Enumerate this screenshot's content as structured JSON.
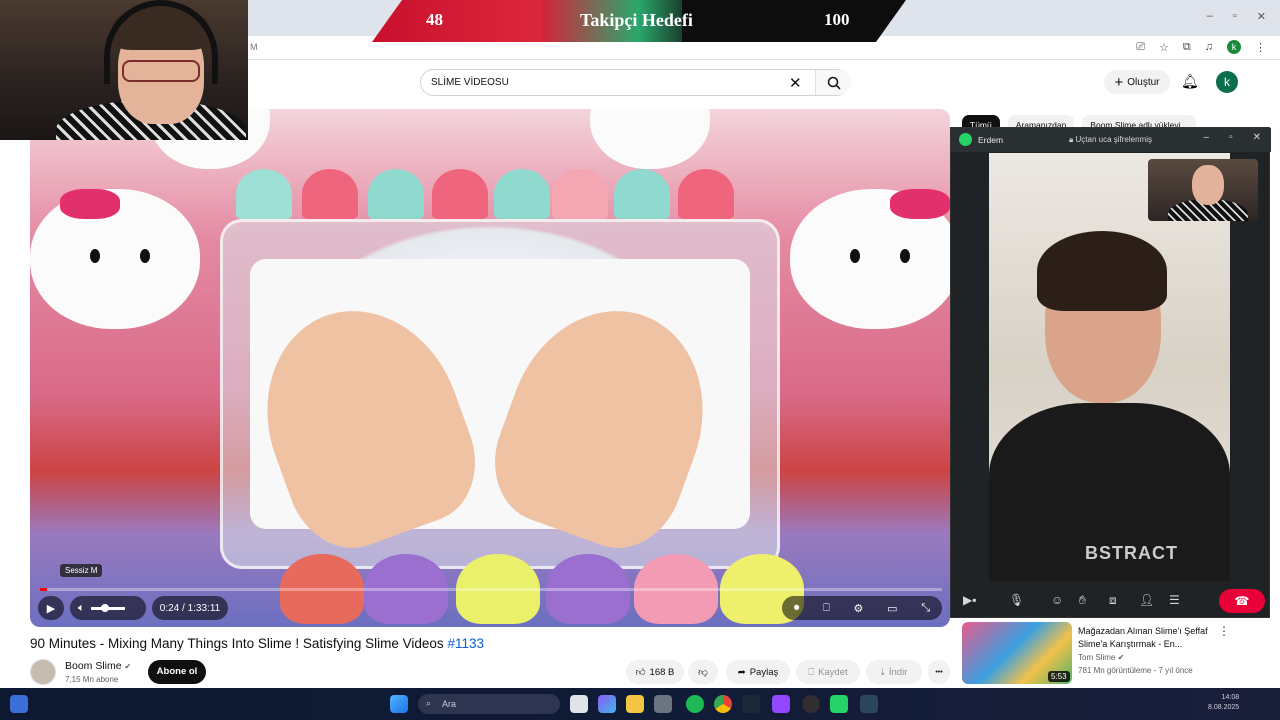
{
  "overlay": {
    "current": "48",
    "title": "Takipçi Hedefi",
    "target": "100",
    "progress_fraction": 0.48
  },
  "browser": {
    "address_fragment": "M",
    "window_controls": {
      "minimize": "–",
      "restore": "▫",
      "close": "✕"
    },
    "icons": [
      "cast-icon",
      "star-icon",
      "extensions-icon",
      "media-icon",
      "profile-icon",
      "menu-icon"
    ],
    "profile_letter": "k"
  },
  "youtube": {
    "search": {
      "value": "SLİME VİDEOSU"
    },
    "create_label": "Oluştur",
    "avatar_letter": "k",
    "video": {
      "mute_tooltip": "Sessiz  M",
      "time_current": "0:24",
      "time_total": "1:33:11",
      "time_display": "0:24 / 1:33:11",
      "progress_fraction": 0.0043,
      "title_text": "90 Minutes - Mixing Many Things Into Slime ! Satisfying Slime Videos ",
      "title_tag": "#1133"
    },
    "channel": {
      "name": "Boom Slime",
      "subs": "7,15 Mn abone",
      "subscribe_label": "Abone ol"
    },
    "actions": {
      "likes": "168 B",
      "share": "Paylaş",
      "save": "Kaydet",
      "download": "İndir",
      "more": "•••"
    },
    "chips": [
      "Tümü",
      "Aramanızdan",
      "Boom Slime adlı yükleyi..."
    ],
    "recommendation": {
      "title": "Mağazadan Alınan Slime'ı Şeffaf Slime'a Karıştırmak - En...",
      "channel": "Tom Slime",
      "meta": "781 Mn görüntüleme - 7 yıl önce",
      "duration": "5:53"
    }
  },
  "whatsapp": {
    "contact": "Erdem",
    "encryption": "Uçtan uca şifrelenmiş",
    "hoodie_text": "BSTRACT"
  },
  "taskbar": {
    "search_placeholder": "Ara",
    "clock_time": "14:08",
    "clock_date": "8.08.2025"
  },
  "colors": {
    "youtube_red": "#ff0000",
    "whatsapp_green": "#25d366",
    "end_call_red": "#ea0038",
    "link_blue": "#065fd4"
  }
}
